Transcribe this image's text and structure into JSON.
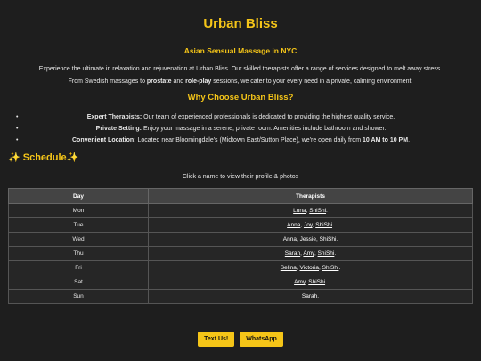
{
  "header": {
    "title": "Urban Bliss",
    "subtitle": "Asian Sensual Massage in NYC"
  },
  "intro": {
    "line1": "Experience the ultimate in relaxation and rejuvenation at Urban Bliss. Our skilled therapists offer a range of services designed to melt away stress.",
    "line2_a": "From Swedish massages to ",
    "line2_b": "prostate",
    "line2_c": " and ",
    "line2_d": "role-play",
    "line2_e": " sessions, we cater to your every need in a private, calming environment."
  },
  "why": {
    "heading": "Why Choose Urban Bliss?",
    "items": [
      {
        "label": "Expert Therapists:",
        "text": " Our team of experienced professionals is dedicated to providing the highest quality service."
      },
      {
        "label": "Private Setting:",
        "text": " Enjoy your massage in a serene, private room. Amenities include bathroom and shower."
      },
      {
        "label": "Convenient Location:",
        "text": " Located near Bloomingdale's (Midtown East/Sutton Place), we're open daily from ",
        "hours": "10 AM to 10 PM",
        "end": "."
      }
    ]
  },
  "schedule": {
    "heading": "✨ Schedule✨",
    "note": "Click a name to view their profile & photos",
    "col_day": "Day",
    "col_therapists": "Therapists",
    "rows": [
      {
        "day": "Mon",
        "names": [
          "Luna",
          "ShiShi"
        ]
      },
      {
        "day": "Tue",
        "names": [
          "Anna",
          "Joy",
          "ShiShi"
        ]
      },
      {
        "day": "Wed",
        "names": [
          "Anna",
          "Jessie",
          "ShiShi"
        ]
      },
      {
        "day": "Thu",
        "names": [
          "Sarah",
          "Amy",
          "ShiShi"
        ]
      },
      {
        "day": "Fri",
        "names": [
          "Selina",
          "Victoria",
          "ShiShi"
        ]
      },
      {
        "day": "Sat",
        "names": [
          "Amy",
          "ShiShi"
        ]
      },
      {
        "day": "Sun",
        "names": [
          "Sarah"
        ]
      }
    ]
  },
  "buttons": {
    "text": "Text Us!",
    "whatsapp": "WhatsApp"
  },
  "colors": {
    "accent": "#f5c518",
    "background": "#1e1e1e"
  }
}
